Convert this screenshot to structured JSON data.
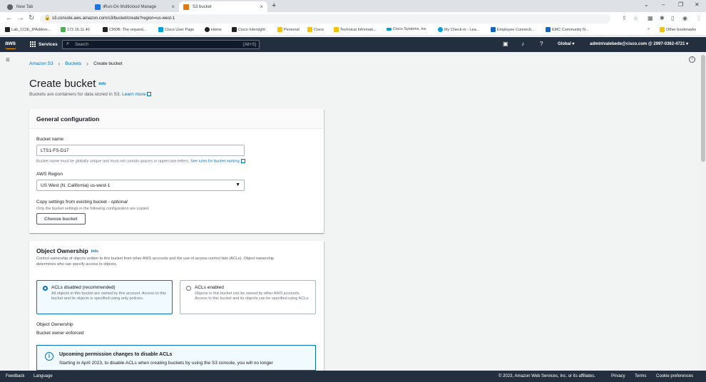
{
  "browser": {
    "tabs": [
      {
        "title": "New Tab",
        "active": false
      },
      {
        "title": "Run-On Multicloud Manage",
        "active": false
      },
      {
        "title": "S3 bucket",
        "active": true
      }
    ],
    "url": "s3.console.aws.amazon.com/s3/bucket/create?region=us-west-1",
    "bookmarks": [
      "Lab_CCIE_IPAddres...",
      "172.16.11.40",
      "CRDB: The request...",
      "Cisco User Page",
      "Home",
      "Cisco Intersight",
      "Personal",
      "Cisco",
      "Technical Informati...",
      "Cisco Systems, Inc",
      "My Check-in - Lea...",
      "Employee Connecti...",
      "EMC Community N..."
    ],
    "other_bookmarks": "Other bookmarks",
    "overflow": "»"
  },
  "aws_header": {
    "logo": "aws",
    "services_label": "Services",
    "search_placeholder": "Search",
    "search_shortcut": "[Alt+S]",
    "region": "Global ▾",
    "account": "admin/valebede@cisco.com @ 2997-0362-4721 ▾"
  },
  "breadcrumb": {
    "items": [
      "Amazon S3",
      "Buckets",
      "Create bucket"
    ]
  },
  "page": {
    "title": "Create bucket",
    "info_label": "Info",
    "description": "Buckets are containers for data stored in S3.",
    "learn_more": "Learn more"
  },
  "general": {
    "heading": "General configuration",
    "bucket_name_label": "Bucket name",
    "bucket_name_value": "LTS1-FS-D17",
    "bucket_name_hint": "Bucket name must be globally unique and must not contain spaces or uppercase letters.",
    "bucket_name_rules": "See rules for bucket naming",
    "region_label": "AWS Region",
    "region_value": "US West (N. California) us-west-1",
    "copy_label": "Copy settings from existing bucket - ",
    "copy_optional": "optional",
    "copy_hint": "Only the bucket settings in the following configuration are copied.",
    "choose_bucket": "Choose bucket"
  },
  "ownership": {
    "heading": "Object Ownership",
    "info_label": "Info",
    "desc_line1": "Control ownership of objects written to this bucket from other AWS accounts and the use of access control lists (ACLs). Object ownership",
    "desc_line2": "determines who can specify access to objects.",
    "options": [
      {
        "title": "ACLs disabled (recommended)",
        "desc": "All objects in this bucket are owned by this account. Access to this bucket and its objects is specified using only policies.",
        "selected": true
      },
      {
        "title": "ACLs enabled",
        "desc": "Objects in this bucket can be owned by other AWS accounts. Access to this bucket and its objects can be specified using ACLs.",
        "selected": false
      }
    ],
    "ownership_label": "Object Ownership",
    "ownership_value": "Bucket owner enforced",
    "flash_title": "Upcoming permission changes to disable ACLs",
    "flash_body": "Starting in April 2023, to disable ACLs when creating buckets by using the S3 console, you will no longer"
  },
  "footer": {
    "feedback": "Feedback",
    "language": "Language",
    "copyright": "© 2023, Amazon Web Services, Inc. or its affiliates.",
    "privacy": "Privacy",
    "terms": "Terms",
    "cookies": "Cookie preferences"
  },
  "colors": {
    "aws_nav": "#232f3e",
    "link": "#0073bb",
    "accent": "#ff9900"
  }
}
